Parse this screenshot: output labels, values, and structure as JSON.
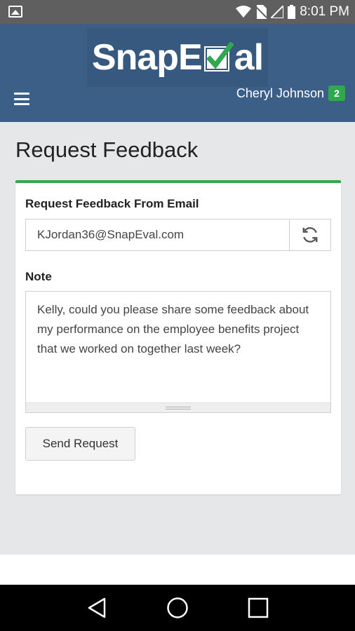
{
  "status_bar": {
    "time": "8:01 PM",
    "icons": [
      "image-icon",
      "wifi-icon",
      "no-sim-icon",
      "signal-icon",
      "battery-icon"
    ]
  },
  "app": {
    "logo_text_left": "SnapE",
    "logo_text_right": "al",
    "user_name": "Cheryl Johnson",
    "badge_count": "2",
    "colors": {
      "header": "#3c5f88",
      "accent_green": "#2fa84f"
    }
  },
  "page": {
    "title": "Request Feedback"
  },
  "form": {
    "email_label": "Request Feedback From Email",
    "email_value": "KJordan36@SnapEval.com",
    "note_label": "Note",
    "note_value": "Kelly, could you please share some feedback about my performance on the employee benefits project that we worked on together last week?",
    "send_label": "Send Request"
  },
  "nav": {
    "icons": [
      "back-icon",
      "home-icon",
      "recents-icon"
    ]
  }
}
